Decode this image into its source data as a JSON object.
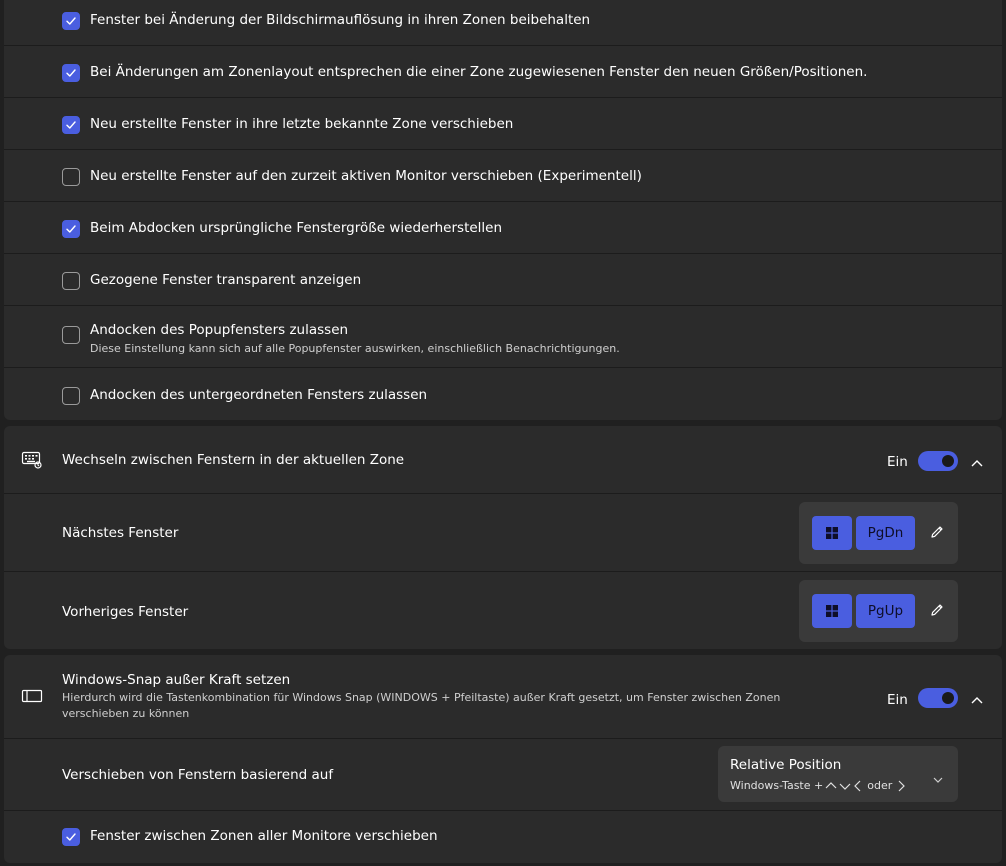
{
  "zone_behavior": {
    "options": [
      {
        "label": "Fenster bei Änderung der Bildschirmauflösung in ihren Zonen beibehalten",
        "checked": true
      },
      {
        "label": "Bei Änderungen am Zonenlayout entsprechen die einer Zone zugewiesenen Fenster den neuen Größen/Positionen.",
        "checked": true
      },
      {
        "label": "Neu erstellte Fenster in ihre letzte bekannte Zone verschieben",
        "checked": true
      },
      {
        "label": "Neu erstellte Fenster auf den zurzeit aktiven Monitor verschieben (Experimentell)",
        "checked": false
      },
      {
        "label": "Beim Abdocken ursprüngliche Fenstergröße wiederherstellen",
        "checked": true
      },
      {
        "label": "Gezogene Fenster transparent anzeigen",
        "checked": false
      },
      {
        "label": "Andocken des Popupfensters zulassen",
        "description": "Diese Einstellung kann sich auf alle Popupfenster auswirken, einschließlich Benachrichtigungen.",
        "checked": false
      },
      {
        "label": "Andocken des untergeordneten Fensters zulassen",
        "checked": false
      }
    ]
  },
  "switch_windows": {
    "title": "Wechseln zwischen Fenstern in der aktuellen Zone",
    "icon": "keyboard-icon",
    "toggle_label": "Ein",
    "toggle_on": true,
    "next_window": {
      "label": "Nächstes Fenster",
      "key": "PgDn"
    },
    "previous_window": {
      "label": "Vorheriges Fenster",
      "key": "PgUp"
    }
  },
  "windows_snap": {
    "title": "Windows-Snap außer Kraft setzen",
    "description": "Hierdurch wird die Tastenkombination für Windows Snap (WINDOWS + Pfeiltaste) außer Kraft gesetzt, um Fenster zwischen Zonen verschieben zu können",
    "icon": "snap-layout-icon",
    "toggle_label": "Ein",
    "toggle_on": true,
    "move_based_on": {
      "label": "Verschieben von Fenstern basierend auf",
      "selected": "Relative Position",
      "hint_prefix": "Windows-Taste +",
      "hint_or": "oder"
    },
    "all_monitors": {
      "label": "Fenster zwischen Zonen aller Monitore verschieben",
      "checked": true
    }
  },
  "colors": {
    "accent": "#4a5ee0",
    "card": "#2b2b2b",
    "background": "#202020"
  }
}
